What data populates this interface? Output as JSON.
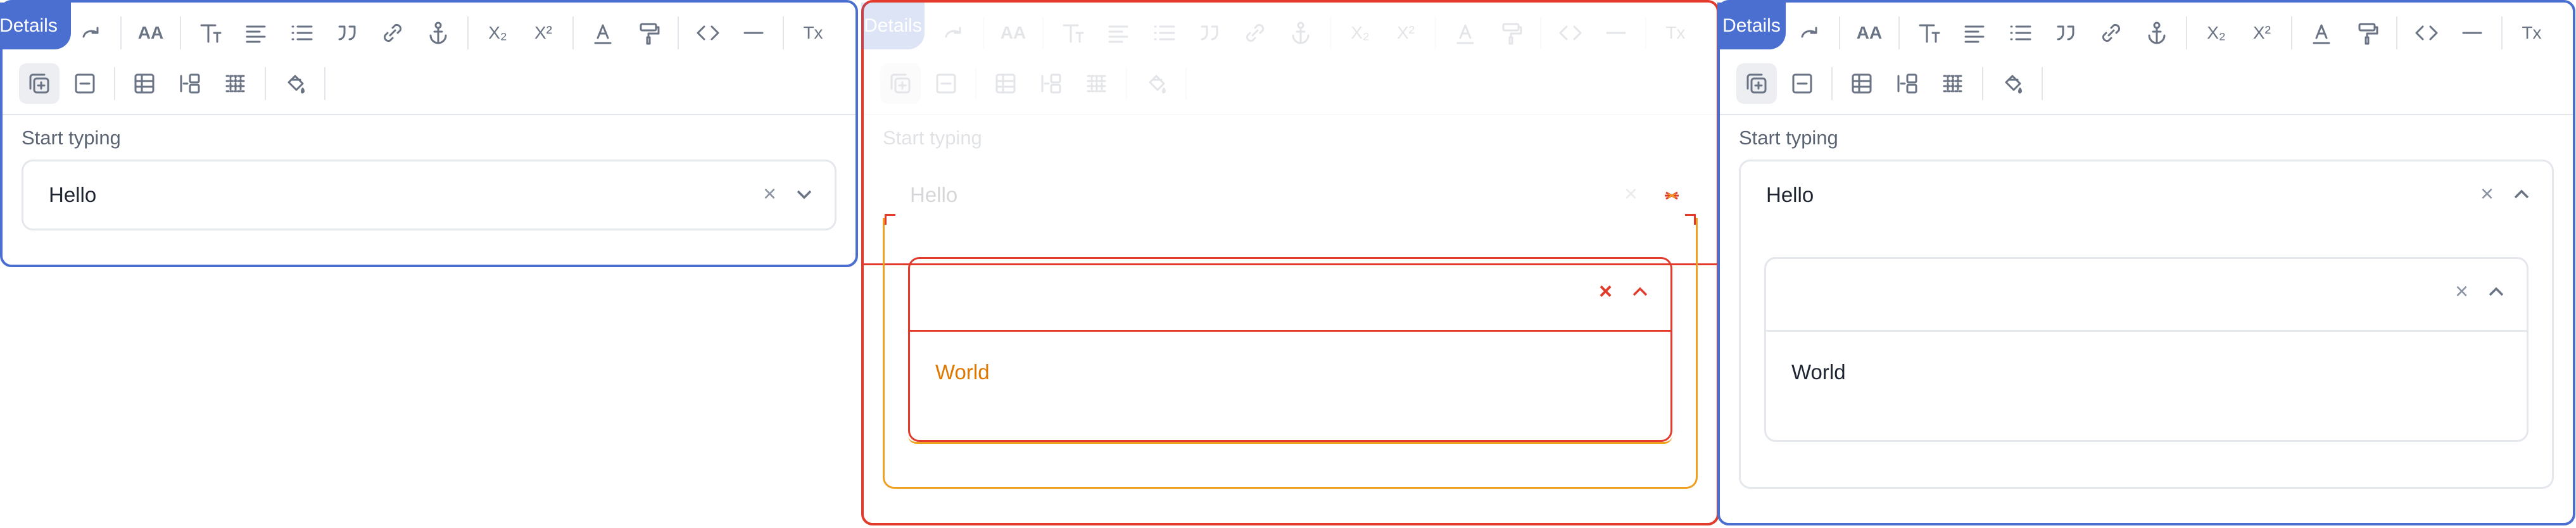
{
  "tab": {
    "label": "Details"
  },
  "toolbar": {
    "row1": [
      "undo-icon",
      "redo-icon",
      "font-size-icon",
      "heading-icon",
      "align-icon",
      "bullet-list-icon",
      "quote-icon",
      "link-icon",
      "anchor-icon",
      "subscript-icon",
      "superscript-icon",
      "text-color-icon",
      "highlighter-icon",
      "code-icon",
      "horizontal-rule-icon",
      "clear-format-icon"
    ],
    "row2": [
      "add-block-icon",
      "remove-block-icon",
      "table-icon",
      "table-column-icon",
      "table-row-icon",
      "paint-bucket-icon"
    ],
    "glyphs": {
      "font_size": "AA",
      "subscript": "X₂",
      "superscript": "X²",
      "clear_format": "Tx"
    }
  },
  "field": {
    "label": "Start typing",
    "value": "Hello",
    "clear_symbol": "×"
  },
  "dropdown": {
    "option": "World",
    "clear_symbol": "×"
  },
  "colors": {
    "accent": "#4a6fd1",
    "error": "#e23b2b",
    "warning": "#f0a020",
    "text": "#1e2430",
    "muted": "#6a7383"
  }
}
